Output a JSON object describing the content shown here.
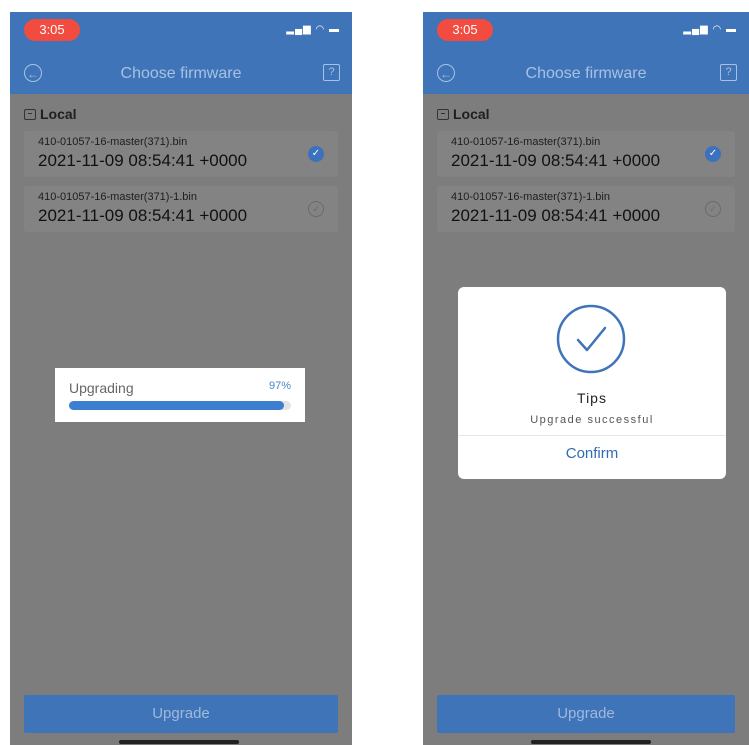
{
  "screens": [
    {
      "status_time": "3:05",
      "status_icons": "▂▄▆ ◠ ▬",
      "nav": {
        "title": "Choose firmware",
        "back_icon": "←",
        "help_icon": "?"
      },
      "section": {
        "label": "Local"
      },
      "files": [
        {
          "name": "410-01057-16-master(371).bin",
          "date": "2021-11-09 08:54:41 +0000",
          "selected": true
        },
        {
          "name": "410-01057-16-master(371)-1.bin",
          "date": "2021-11-09 08:54:41 +0000",
          "selected": false
        }
      ],
      "upgrade_label": "Upgrade",
      "progress": {
        "label": "Upgrading",
        "percent_text": "97%",
        "percent": 97
      }
    },
    {
      "status_time": "3:05",
      "status_icons": "▂▄▆ ◠ ▬",
      "nav": {
        "title": "Choose firmware",
        "back_icon": "←",
        "help_icon": "?"
      },
      "section": {
        "label": "Local"
      },
      "files": [
        {
          "name": "410-01057-16-master(371).bin",
          "date": "2021-11-09 08:54:41 +0000",
          "selected": true
        },
        {
          "name": "410-01057-16-master(371)-1.bin",
          "date": "2021-11-09 08:54:41 +0000",
          "selected": false
        }
      ],
      "upgrade_label": "Upgrade",
      "tips": {
        "title": "Tips",
        "message": "Upgrade successful",
        "confirm_label": "Confirm"
      }
    }
  ],
  "colors": {
    "accent": "#3f75b8",
    "overlay": "#7d7d7d",
    "alert": "#f24b3f",
    "progress": "#3c7fd0"
  }
}
